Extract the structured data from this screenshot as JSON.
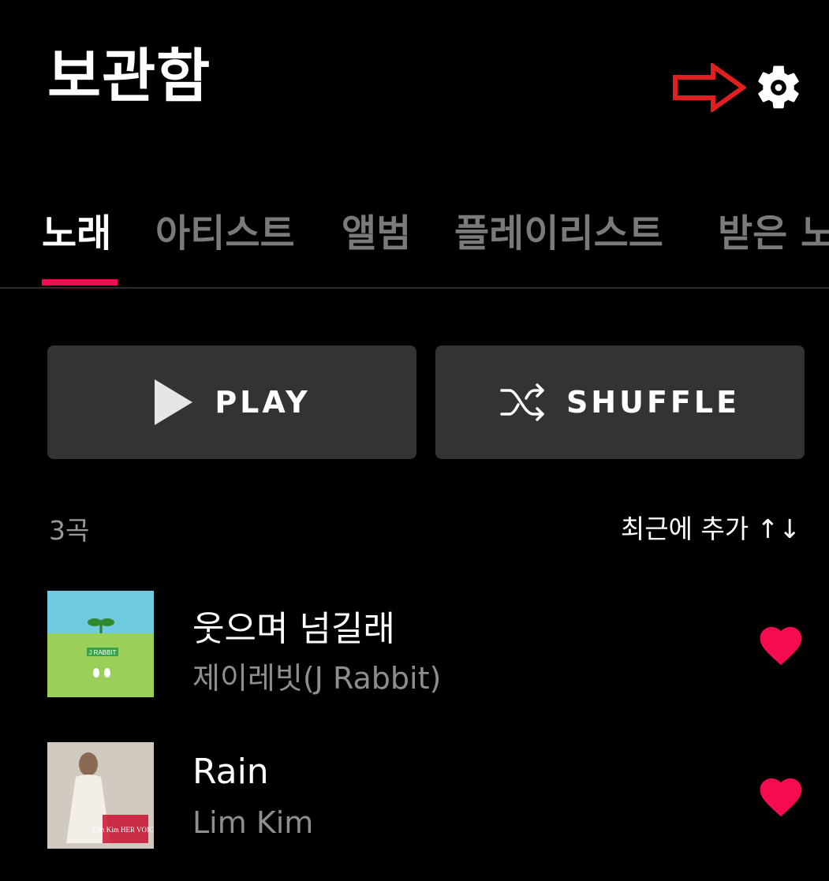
{
  "header": {
    "title": "보관함",
    "settings_icon": "gear-icon",
    "annotation_arrow_color": "#e02020"
  },
  "tabs": [
    {
      "label": "노래",
      "active": true
    },
    {
      "label": "아티스트",
      "active": false
    },
    {
      "label": "앨범",
      "active": false
    },
    {
      "label": "플레이리스트",
      "active": false
    },
    {
      "label": "받은 노",
      "active": false
    }
  ],
  "accent_color": "#f50b4f",
  "actions": {
    "play_label": "PLAY",
    "shuffle_label": "SHUFFLE"
  },
  "list_info": {
    "count": "3곡",
    "sort_label": "최근에 추가 ↑↓"
  },
  "songs": [
    {
      "title": "웃으며 넘길래",
      "artist": "제이레빗(J Rabbit)",
      "liked": true,
      "art_text": "J RABBIT"
    },
    {
      "title": "Rain",
      "artist": "Lim Kim",
      "liked": true,
      "art_text": "Lim Kim HER VOICE"
    }
  ]
}
